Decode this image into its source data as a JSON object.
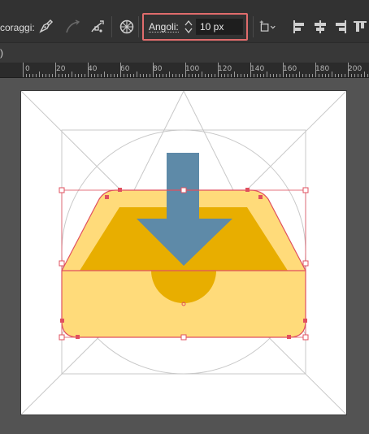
{
  "control_bar": {
    "label_fragment": "coraggi:",
    "angoli": {
      "label": "Angoli:",
      "value": "10 px"
    }
  },
  "tab_row": {
    "fragment": ")"
  },
  "ruler": {
    "labels": [
      "0",
      "20",
      "40",
      "60",
      "80",
      "100",
      "120",
      "140",
      "160",
      "180",
      "200"
    ]
  },
  "colors": {
    "tray_light": "#FFDB7A",
    "tray_dark": "#E8AE00",
    "arrow": "#5E8AA8",
    "selection": "#E0505F",
    "guide": "#C8C8C8",
    "highlight_box": "#E06C6C"
  },
  "icons": {
    "pen_tool": "pen-anchor-icon",
    "curve_tool": "curvature-icon",
    "convert_anchor": "convert-anchor-icon",
    "globe": "globe-icon",
    "transform": "transform-dropdown-icon",
    "align_left": "align-left-icon",
    "align_center": "align-center-icon",
    "align_right": "align-right-icon",
    "align_top": "align-top-icon"
  }
}
